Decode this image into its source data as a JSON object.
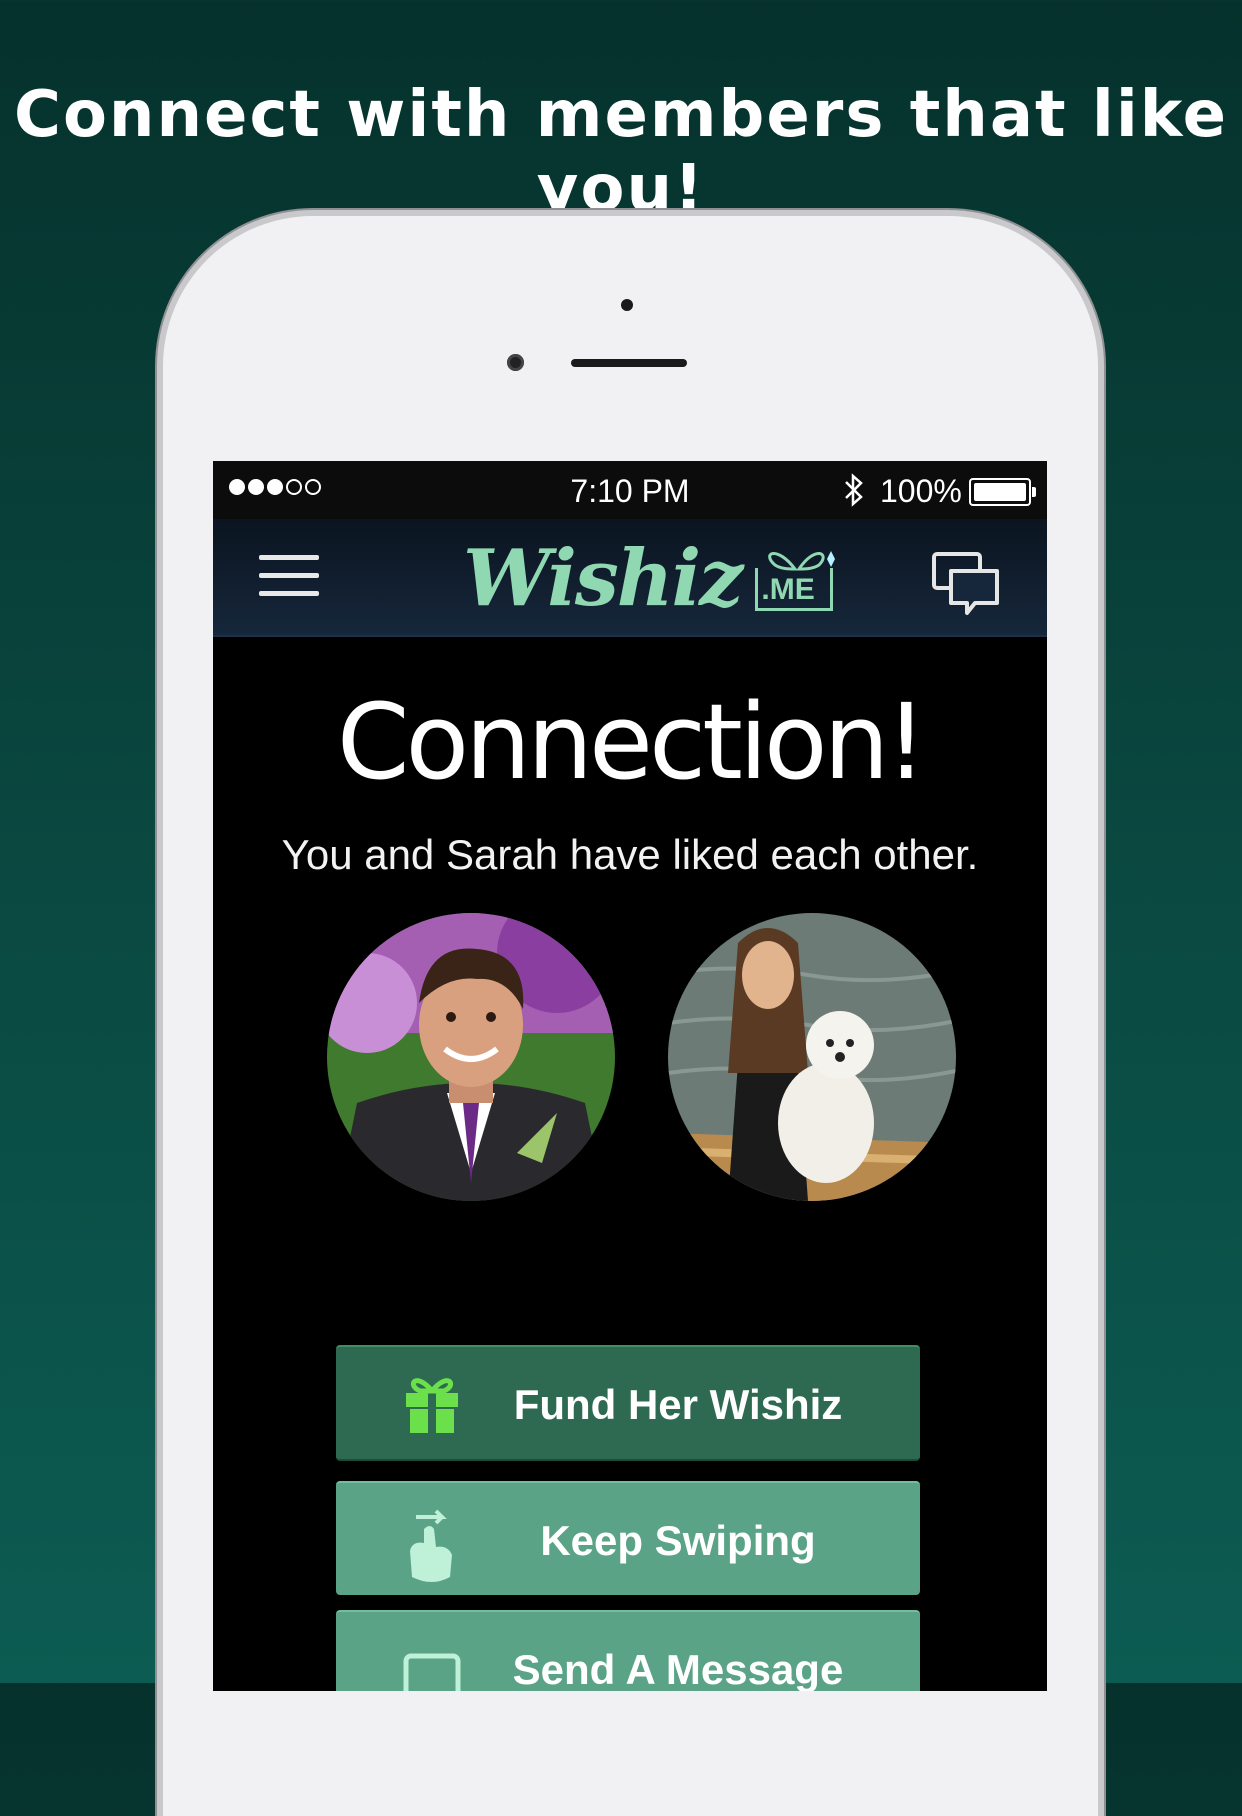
{
  "marketing": {
    "headline": "Connect with members that like you!"
  },
  "status_bar": {
    "time": "7:10 PM",
    "battery": "100%",
    "bluetooth_glyph": "✱"
  },
  "nav": {
    "logo_text": "Wishiz",
    "logo_suffix": ".ME"
  },
  "match": {
    "title": "Connection!",
    "subtitle": "You and Sarah have liked each other."
  },
  "actions": {
    "fund_label": "Fund Her Wishiz",
    "swipe_label": "Keep Swiping",
    "message_label": "Send A Message"
  },
  "colors": {
    "brand_green": "#8fd8b2",
    "fund_button": "#2e6a51",
    "secondary_button": "#5aa386",
    "gift_icon": "#6be04a"
  },
  "icons": {
    "menu": "hamburger-icon",
    "chat": "chat-bubbles-icon",
    "gift": "gift-icon",
    "swipe": "swipe-hand-icon",
    "message": "message-icon"
  }
}
